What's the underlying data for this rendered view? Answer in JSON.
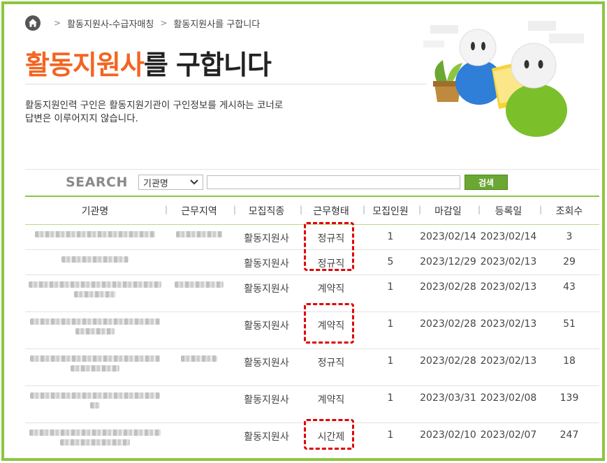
{
  "breadcrumb": {
    "items": [
      "활동지원사-수급자매칭",
      "활동지원사를 구합니다"
    ]
  },
  "title": {
    "accent": "활동지원사",
    "rest": "를 구합니다"
  },
  "description": [
    "활동지원인력 구인은 활동지원기관이 구인정보를 게시하는 코너로",
    "답변은 이루어지지 않습니다."
  ],
  "search": {
    "label": "SEARCH",
    "select_value": "기관명",
    "input_value": "",
    "button_label": "검색"
  },
  "table": {
    "headers": [
      "기관명",
      "근무지역",
      "모집직종",
      "근무형태",
      "모집인원",
      "마감일",
      "등록일",
      "조회수"
    ],
    "rows": [
      {
        "job": "활동지원사",
        "type": "정규직",
        "count": "1",
        "deadline": "2023/02/14",
        "registered": "2023/02/14",
        "views": "3"
      },
      {
        "job": "활동지원사",
        "type": "정규직",
        "count": "5",
        "deadline": "2023/12/29",
        "registered": "2023/02/13",
        "views": "29"
      },
      {
        "job": "활동지원사",
        "type": "계약직",
        "count": "1",
        "deadline": "2023/02/28",
        "registered": "2023/02/13",
        "views": "43"
      },
      {
        "job": "활동지원사",
        "type": "계약직",
        "count": "1",
        "deadline": "2023/02/28",
        "registered": "2023/02/13",
        "views": "51"
      },
      {
        "job": "활동지원사",
        "type": "정규직",
        "count": "1",
        "deadline": "2023/02/28",
        "registered": "2023/02/13",
        "views": "18"
      },
      {
        "job": "활동지원사",
        "type": "계약직",
        "count": "1",
        "deadline": "2023/03/31",
        "registered": "2023/02/08",
        "views": "139"
      },
      {
        "job": "활동지원사",
        "type": "시간제",
        "count": "1",
        "deadline": "2023/02/10",
        "registered": "2023/02/07",
        "views": "247"
      }
    ]
  },
  "colors": {
    "accent": "#f26522",
    "frame": "#8cc63f",
    "button": "#6aa733",
    "highlight": "#e00000"
  },
  "icons": [
    "home-icon",
    "chevron-right-icon",
    "chevron-down-icon"
  ]
}
